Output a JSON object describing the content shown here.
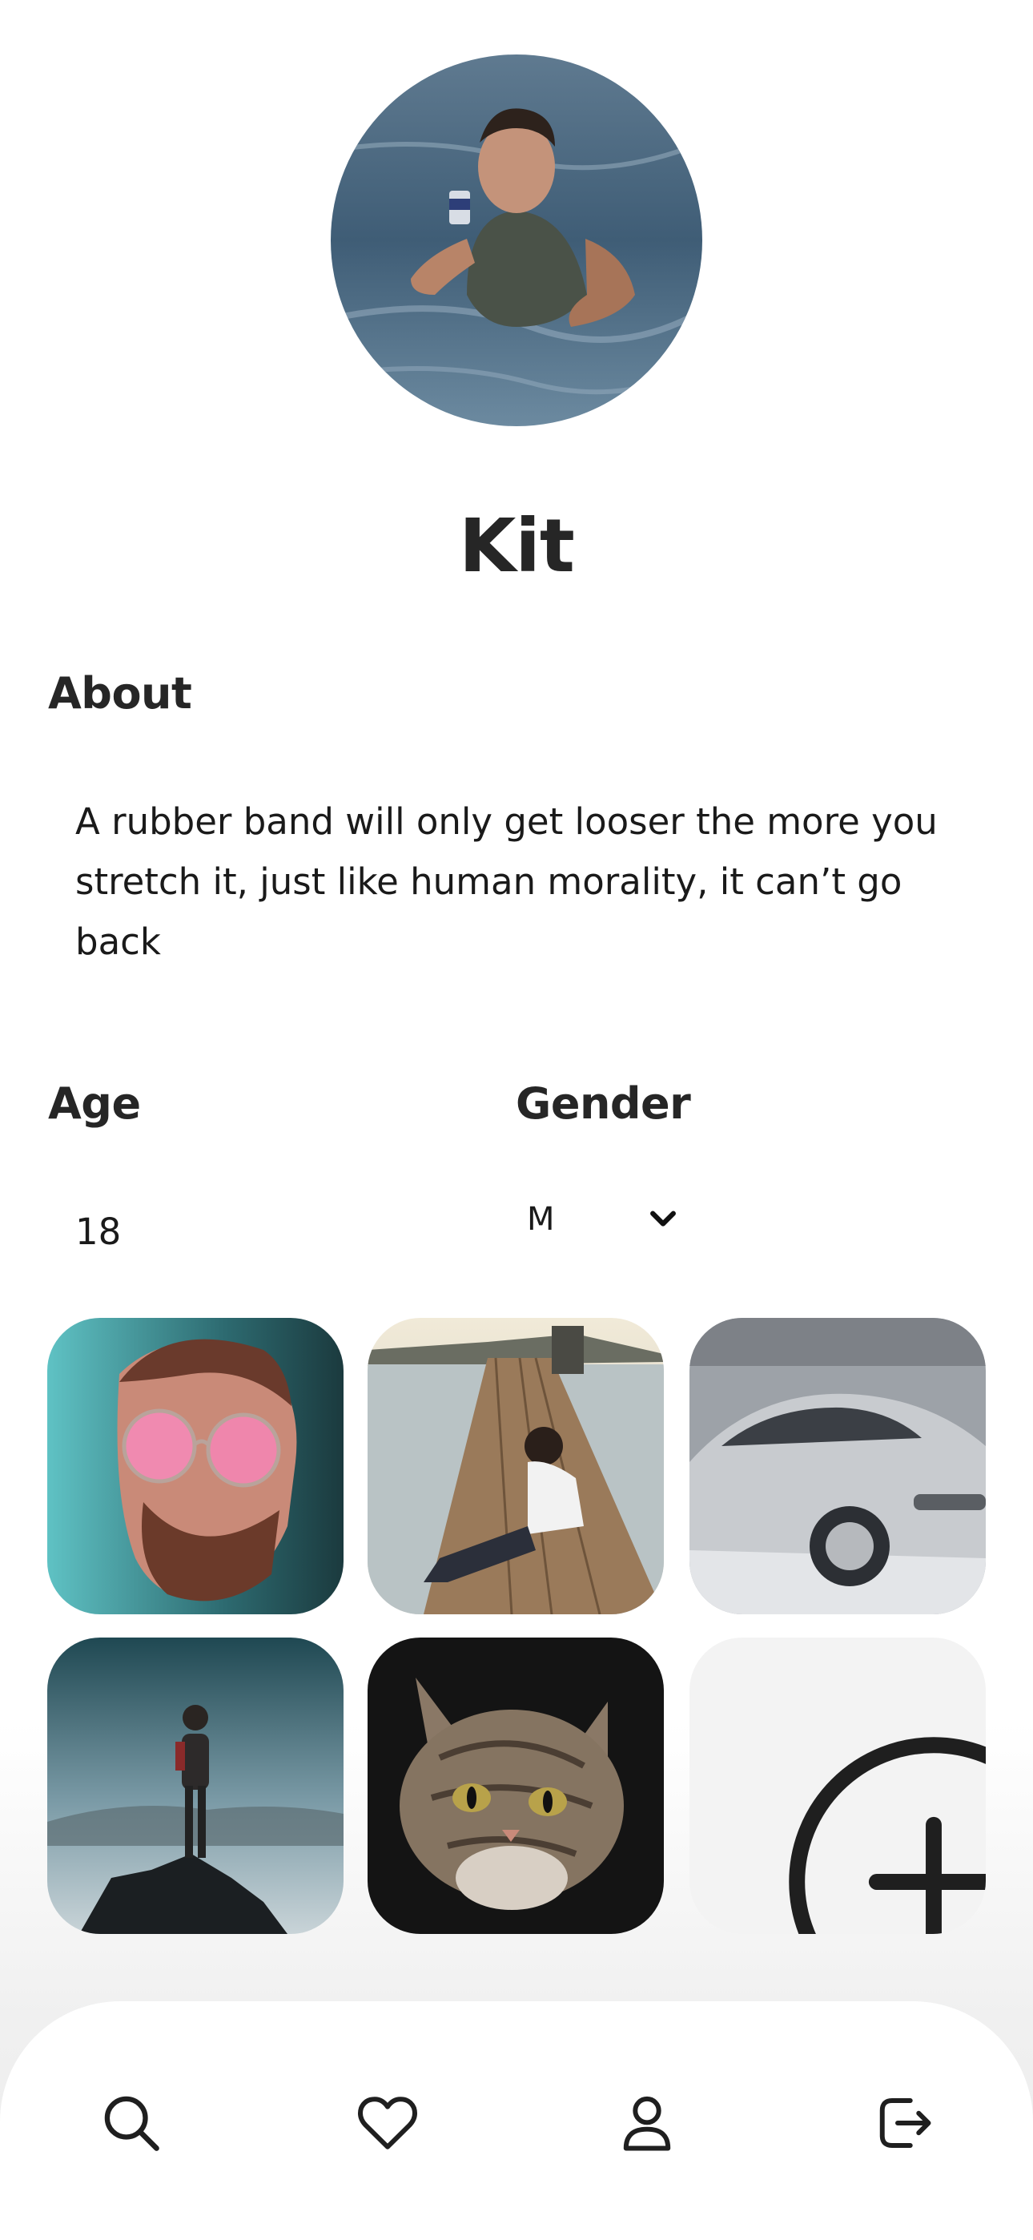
{
  "profile": {
    "name": "Kit",
    "about_label": "About",
    "about_text": "A rubber band will only get looser the more you stretch it, just like human morality, it can’t go back",
    "age_label": "Age",
    "age_value": "18",
    "gender_label": "Gender",
    "gender_value": "M"
  },
  "photos": [
    {
      "icon": "portrait-sunglasses-photo"
    },
    {
      "icon": "pier-couple-photo"
    },
    {
      "icon": "silver-car-photo"
    },
    {
      "icon": "hiker-mountain-photo"
    },
    {
      "icon": "kitten-photo"
    }
  ],
  "nav": {
    "items": [
      {
        "icon": "search-icon"
      },
      {
        "icon": "heart-icon"
      },
      {
        "icon": "user-icon"
      },
      {
        "icon": "logout-icon"
      }
    ]
  },
  "colors": {
    "text": "#262626",
    "tile_empty": "#f3f3f3",
    "nav_bg": "#ffffff"
  }
}
